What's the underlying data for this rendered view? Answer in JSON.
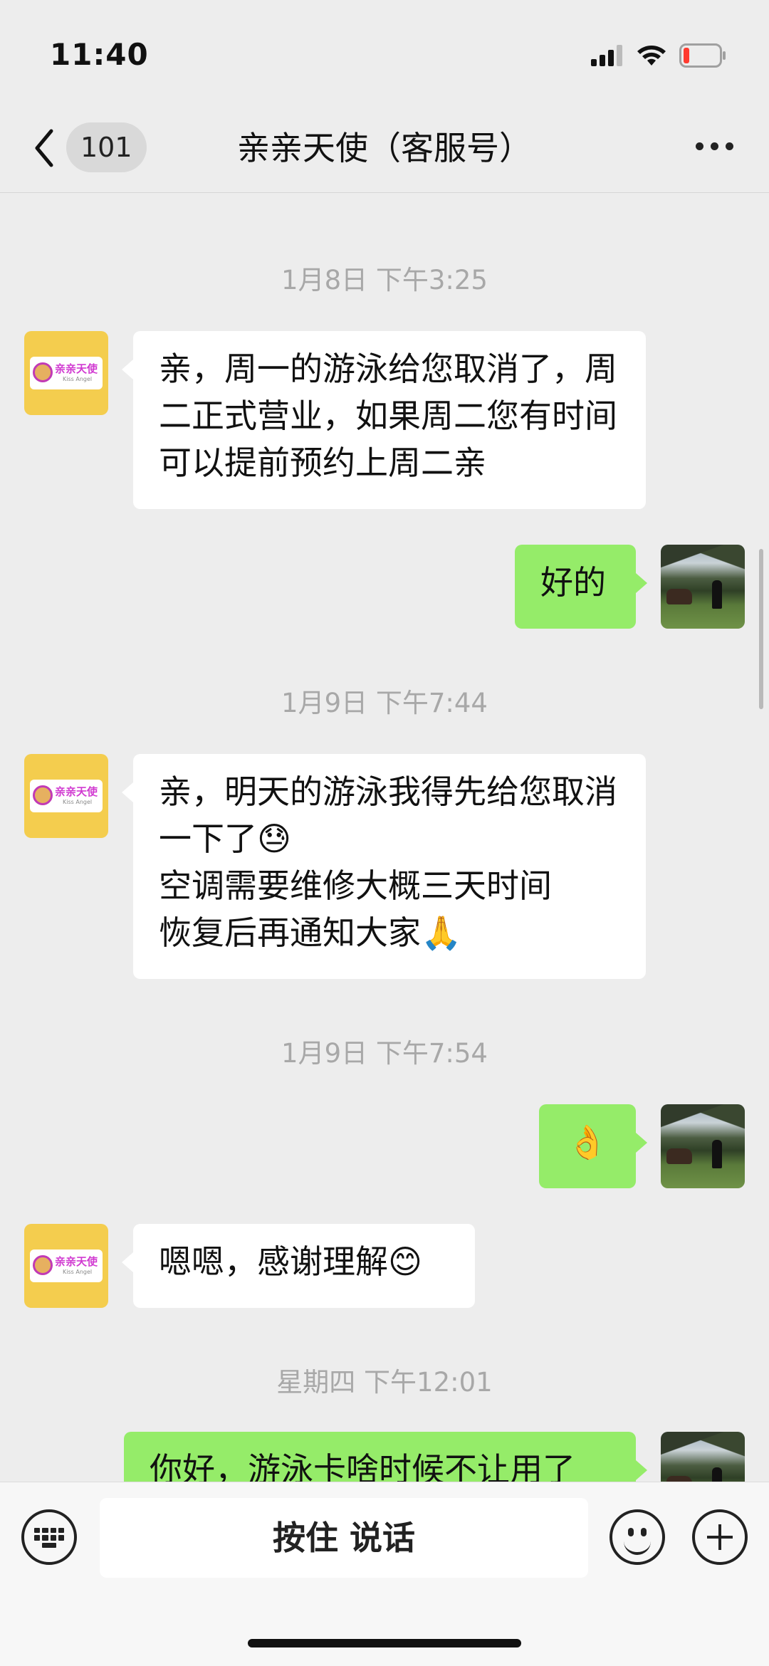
{
  "status_bar": {
    "time": "11:40",
    "battery_color": "#ff3b30"
  },
  "nav": {
    "back_icon": "chevron-left-icon",
    "unread_count": "101",
    "title": "亲亲天使（客服号）",
    "more_icon": "more-dots-icon"
  },
  "brand": {
    "logo_text": "亲亲天使",
    "logo_sub": "Kiss Angel"
  },
  "chat": {
    "timestamps": [
      "1月8日 下午3:25",
      "1月9日 下午7:44",
      "1月9日 下午7:54",
      "星期四 下午12:01"
    ],
    "messages": [
      {
        "side": "in",
        "text": "亲，周一的游泳给您取消了，周二正式营业，如果周二您有时间可以提前预约上周二亲"
      },
      {
        "side": "out",
        "text": "好的"
      },
      {
        "side": "in",
        "text": "亲，明天的游泳我得先给您取消一下了😓\n空调需要维修大概三天时间\n恢复后再通知大家🙏"
      },
      {
        "side": "out",
        "text": "👌"
      },
      {
        "side": "in",
        "text": "嗯嗯，感谢理解😊"
      },
      {
        "side": "out",
        "text": "你好，游泳卡啥时候不让用了"
      }
    ]
  },
  "input_bar": {
    "keyboard_icon": "keyboard-icon",
    "talk_label": "按住 说话",
    "emoji_icon": "emoji-icon",
    "plus_icon": "plus-icon"
  },
  "colors": {
    "incoming_bubble": "#ffffff",
    "outgoing_bubble": "#95ec69",
    "background": "#ededed"
  }
}
